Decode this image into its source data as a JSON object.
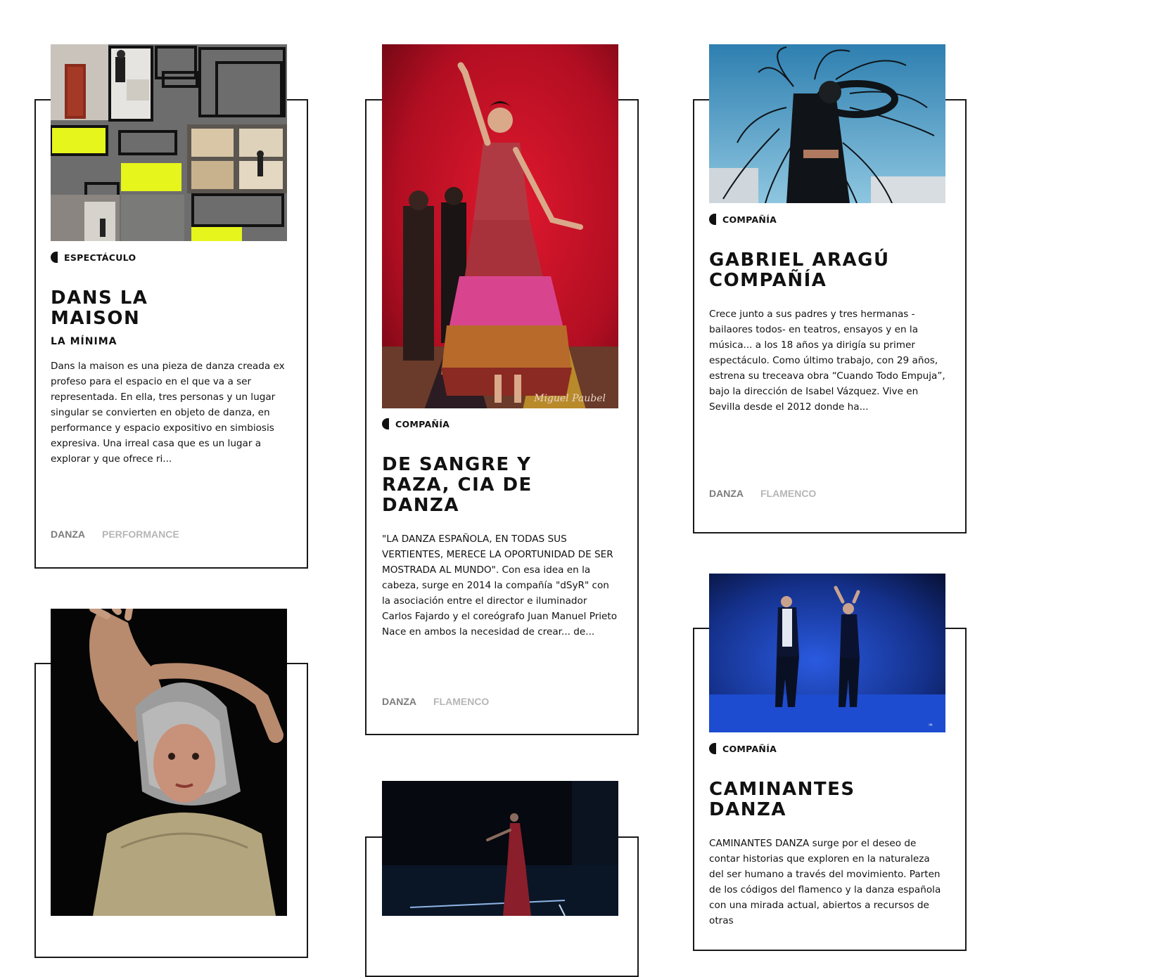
{
  "cards": [
    {
      "category": "ESPECTÁCULO",
      "title": "DANS LA MAISON",
      "subtitle": "LA MÍNIMA",
      "description": "Dans la maison es una pieza de danza creada ex profeso para el espacio en el que va a ser representada. En ella, tres personas y un lugar singular se convierten en objeto de danza, en performance y espacio expositivo en simbiosis expresiva. Una irreal casa que es un lugar a explorar y que ofrece ri...",
      "tags": [
        "DANZA",
        "PERFORMANCE"
      ]
    },
    {
      "category": "COMPAÑÍA",
      "title": "DE SANGRE Y RAZA, CIA DE DANZA",
      "description": "\"LA DANZA ESPAÑOLA, EN TODAS SUS VERTIENTES, MERECE LA OPORTUNIDAD DE SER MOSTRADA AL MUNDO\".  Con esa idea en la cabeza, surge en 2014 la compañía \"dSyR\" con la asociación entre el director e iluminador Carlos Fajardo y el coreógrafo Juan Manuel Prieto  Nace en ambos la necesidad de crear... de...",
      "tags": [
        "DANZA",
        "FLAMENCO"
      ],
      "photo_credit": "Miguel Paubel"
    },
    {
      "category": "COMPAÑÍA",
      "title": "GABRIEL ARAGÚ COMPAÑÍA",
      "description": "Crece junto a sus padres y tres hermanas - bailaores todos- en teatros, ensayos y en la música... a los 18 años ya dirigía su primer espectáculo. Como último trabajo, con 29 años, estrena su treceava obra “Cuando Todo Empuja”, bajo la dirección de Isabel Vázquez. Vive en Sevilla desde el 2012 donde ha...",
      "tags": [
        "DANZA",
        "FLAMENCO"
      ]
    },
    {
      "category": "COMPAÑÍA",
      "title": "CAMINANTES DANZA",
      "description": "CAMINANTES DANZA surge por el deseo de contar historias que exploren en la naturaleza del ser humano a través del movimiento. Parten de los códigos del flamenco y la danza española con una mirada actual, abiertos a recursos de otras"
    }
  ],
  "colors": {
    "border": "#1a1a1a",
    "tag_primary": "#7c7c7c",
    "tag_secondary": "#b6b6b6",
    "accent_yellow": "#e6f51b",
    "red_stage": "#c80f26",
    "blue_stage": "#1a3fa8"
  }
}
